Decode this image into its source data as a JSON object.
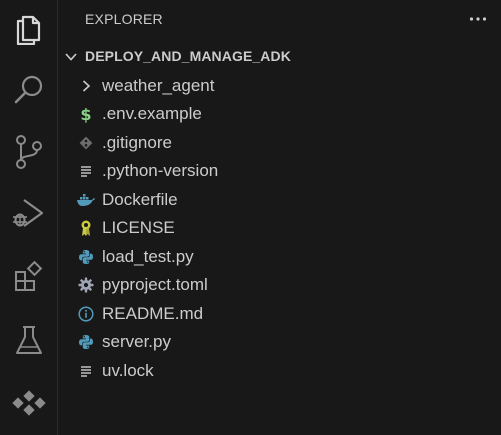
{
  "activity_bar": {
    "items": [
      {
        "name": "explorer-icon",
        "active": true
      },
      {
        "name": "search-icon"
      },
      {
        "name": "source-control-icon"
      },
      {
        "name": "run-debug-icon"
      },
      {
        "name": "extensions-icon"
      },
      {
        "name": "testing-icon"
      },
      {
        "name": "remote-explorer-icon"
      }
    ]
  },
  "sidebar": {
    "title": "EXPLORER",
    "more_icon": "ellipsis-icon",
    "section_title": "DEPLOY_AND_MANAGE_ADK",
    "items": [
      {
        "label": "weather_agent",
        "icon": "chevron-right-icon",
        "type": "folder"
      },
      {
        "label": ".env.example",
        "icon": "dollar-icon",
        "color": "#89d185"
      },
      {
        "label": ".gitignore",
        "icon": "git-icon",
        "color": "#6d6d6d"
      },
      {
        "label": ".python-version",
        "icon": "lines-icon",
        "color": "#cccccc"
      },
      {
        "label": "Dockerfile",
        "icon": "docker-icon",
        "color": "#519aba"
      },
      {
        "label": "LICENSE",
        "icon": "license-icon",
        "color": "#cbcb41"
      },
      {
        "label": "load_test.py",
        "icon": "python-icon",
        "color": "#519aba"
      },
      {
        "label": "pyproject.toml",
        "icon": "gear-icon",
        "color": "#9da5b4"
      },
      {
        "label": "README.md",
        "icon": "info-icon",
        "color": "#519aba"
      },
      {
        "label": "server.py",
        "icon": "python-icon",
        "color": "#519aba"
      },
      {
        "label": "uv.lock",
        "icon": "lines-icon",
        "color": "#cccccc"
      }
    ]
  }
}
